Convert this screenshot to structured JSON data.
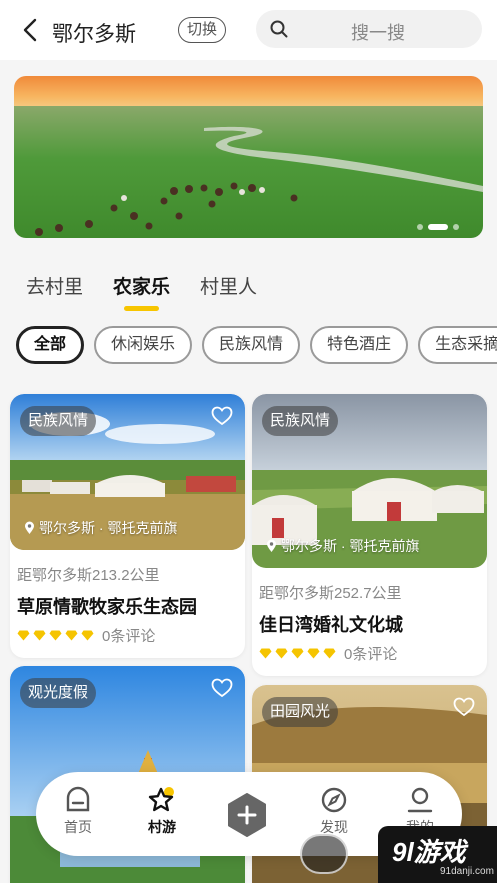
{
  "header": {
    "city": "鄂尔多斯",
    "switch_label": "切换",
    "search_placeholder": "搜一搜"
  },
  "banner": {
    "watermark": "9l游戏",
    "watermark_sub": "91danji.com",
    "page_count": 3,
    "active_page": 2
  },
  "tabs": [
    {
      "label": "去村里",
      "active": false
    },
    {
      "label": "农家乐",
      "active": true
    },
    {
      "label": "村里人",
      "active": false
    }
  ],
  "chips": [
    {
      "label": "全部",
      "active": true
    },
    {
      "label": "休闲娱乐",
      "active": false
    },
    {
      "label": "民族风情",
      "active": false
    },
    {
      "label": "特色酒庄",
      "active": false
    },
    {
      "label": "生态采摘",
      "active": false
    }
  ],
  "cards": [
    {
      "tag": "民族风情",
      "location": "鄂尔多斯 · 鄂托克前旗",
      "distance": "距鄂尔多斯213.2公里",
      "name": "草原情歌牧家乐生态园",
      "rating": 5,
      "reviews": "0条评论"
    },
    {
      "tag": "民族风情",
      "location": "鄂尔多斯 · 鄂托克前旗",
      "distance": "距鄂尔多斯252.7公里",
      "name": "佳日湾婚礼文化城",
      "rating": 5,
      "reviews": "0条评论"
    },
    {
      "tag": "观光度假"
    },
    {
      "tag": "田园风光"
    }
  ],
  "nav": [
    {
      "label": "首页",
      "icon": "home-icon",
      "active": false
    },
    {
      "label": "村游",
      "icon": "star-icon",
      "active": true
    },
    {
      "label": "",
      "icon": "plus-icon",
      "active": false
    },
    {
      "label": "发现",
      "icon": "compass-icon",
      "active": false
    },
    {
      "label": "我的",
      "icon": "user-icon",
      "active": false
    }
  ],
  "watermark": {
    "text": "9l游戏",
    "sub": "91danji.com"
  },
  "colors": {
    "accent": "#f7c500",
    "rating": "#f5c400",
    "text": "#222222"
  }
}
